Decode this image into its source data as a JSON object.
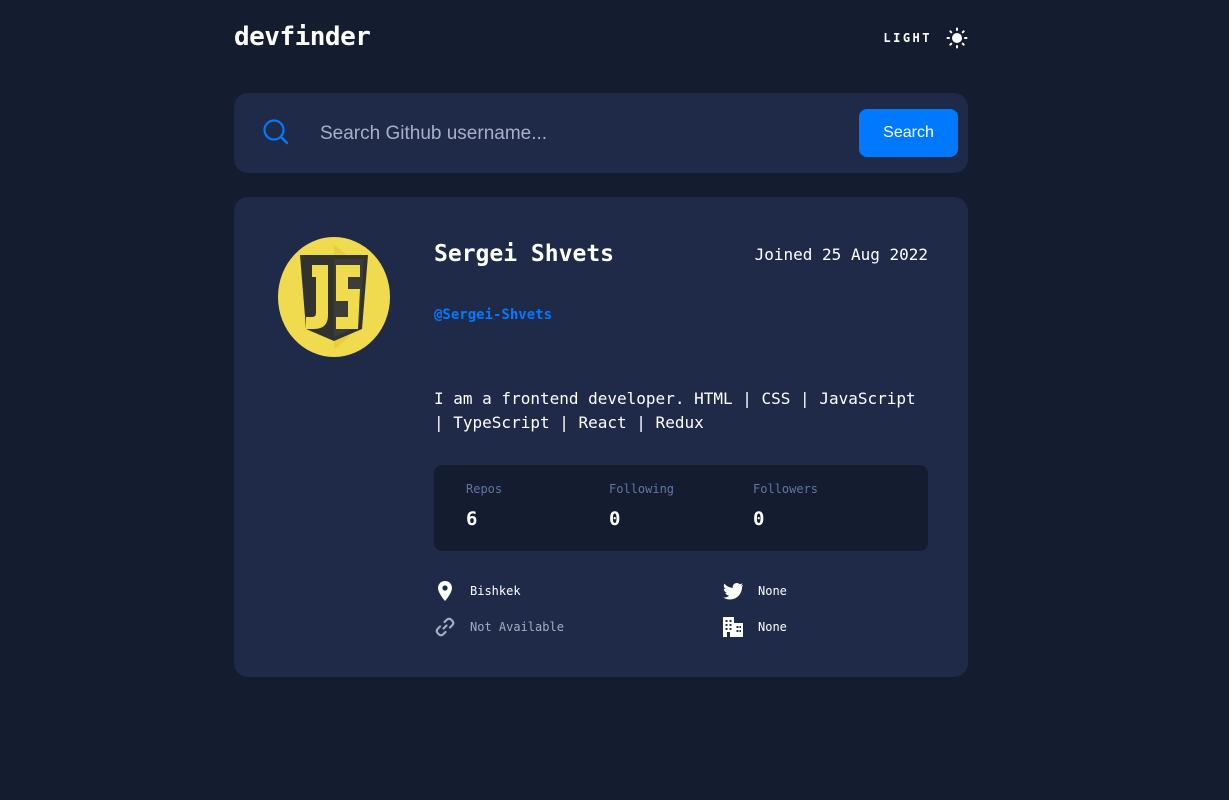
{
  "header": {
    "logo": "devfinder",
    "theme_label": "LIGHT",
    "theme_icon": "sun-icon"
  },
  "search": {
    "placeholder": "Search Github username...",
    "value": "",
    "button_label": "Search",
    "icon": "search-icon"
  },
  "profile": {
    "avatar": "javascript-logo-avatar",
    "name": "Sergei Shvets",
    "joined": "Joined 25 Aug 2022",
    "login": "@Sergei-Shvets",
    "bio": "I am a frontend developer. HTML | CSS | JavaScript | TypeScript | React | Redux",
    "stats": {
      "repos_label": "Repos",
      "repos_value": "6",
      "following_label": "Following",
      "following_value": "0",
      "followers_label": "Followers",
      "followers_value": "0"
    },
    "links": {
      "location": {
        "icon": "location-pin-icon",
        "text": "Bishkek"
      },
      "blog": {
        "icon": "link-icon",
        "text": "Not Available"
      },
      "twitter": {
        "icon": "twitter-icon",
        "text": "None"
      },
      "company": {
        "icon": "building-icon",
        "text": "None"
      }
    }
  },
  "colors": {
    "background": "#141c2f",
    "card": "#1f2a48",
    "accent": "#0079ff",
    "muted": "#a3adc2",
    "stat_label": "#5f76a8"
  }
}
